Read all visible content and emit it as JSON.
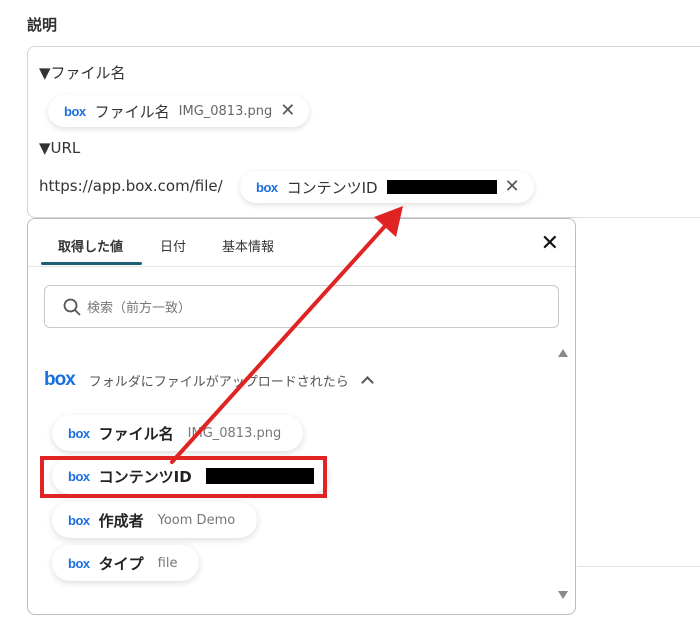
{
  "section_label": "説明",
  "description": {
    "line1": "▼ファイル名",
    "chip1": {
      "logo": "box",
      "name": "ファイル名",
      "value": "IMG_0813.png"
    },
    "line2": "▼URL",
    "url_prefix": "https://app.box.com/file/",
    "chip2": {
      "logo": "box",
      "name": "コンテンツID"
    }
  },
  "popup": {
    "tabs": [
      {
        "label": "取得した値",
        "active": true
      },
      {
        "label": "日付",
        "active": false
      },
      {
        "label": "基本情報",
        "active": false
      }
    ],
    "close_icon": "close-icon",
    "search": {
      "placeholder": "検索（前方一致）",
      "icon": "search-icon"
    },
    "group": {
      "logo": "box",
      "title": "フォルダにファイルがアップロードされたら"
    },
    "items": [
      {
        "logo": "box",
        "name": "ファイル名",
        "value": "IMG_0813.png"
      },
      {
        "logo": "box",
        "name": "コンテンツID",
        "value": ""
      },
      {
        "logo": "box",
        "name": "作成者",
        "value": "Yoom Demo"
      },
      {
        "logo": "box",
        "name": "タイプ",
        "value": "file"
      }
    ]
  },
  "colors": {
    "annotation_red": "#e02323",
    "box_blue": "#1a6fe0",
    "tab_underline": "#1f5e74"
  }
}
